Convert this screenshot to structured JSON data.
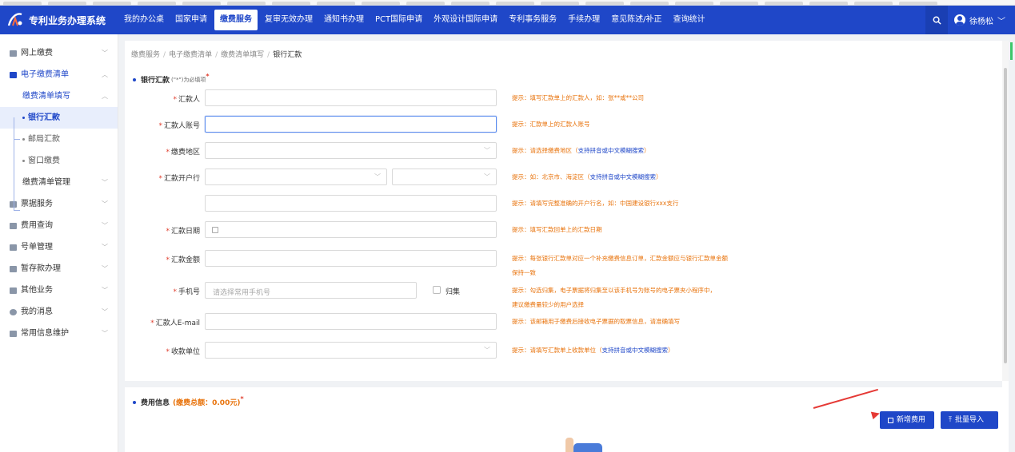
{
  "app": {
    "title": "专利业务办理系统"
  },
  "nav": {
    "items": [
      {
        "label": "我的办公桌"
      },
      {
        "label": "国家申请"
      },
      {
        "label": "缴费服务"
      },
      {
        "label": "复审无效办理"
      },
      {
        "label": "通知书办理"
      },
      {
        "label": "PCT国际申请"
      },
      {
        "label": "外观设计国际申请"
      },
      {
        "label": "专利事务服务"
      },
      {
        "label": "手续办理"
      },
      {
        "label": "意见陈述/补正"
      },
      {
        "label": "查询统计"
      }
    ],
    "active_index": 2,
    "user": "徐杨松"
  },
  "sidebar": {
    "items": [
      {
        "label": "网上缴费"
      },
      {
        "label": "电子缴费清单"
      },
      {
        "label": "缴费清单填写"
      },
      {
        "label": "银行汇款"
      },
      {
        "label": "邮局汇款"
      },
      {
        "label": "窗口缴费"
      },
      {
        "label": "缴费清单管理"
      },
      {
        "label": "票据服务"
      },
      {
        "label": "费用查询"
      },
      {
        "label": "号单管理"
      },
      {
        "label": "暂存款办理"
      },
      {
        "label": "其他业务"
      },
      {
        "label": "我的消息"
      },
      {
        "label": "常用信息维护"
      }
    ]
  },
  "breadcrumb": [
    "缴费服务",
    "电子缴费清单",
    "缴费清单填写",
    "银行汇款"
  ],
  "form": {
    "section_title": "银行汇款",
    "section_note": "(\"*\")为必填项",
    "fields": {
      "remitter": {
        "label": "汇款人",
        "hint": "提示：填写汇款单上的汇款人，如：张**或**公司"
      },
      "account": {
        "label": "汇款人账号",
        "hint": "提示：汇款单上的汇款人账号"
      },
      "region": {
        "label": "缴费地区",
        "hint": "提示：请选择缴费地区（",
        "hint_blue": "支持拼音或中文模糊搜索",
        "hint_end": "）"
      },
      "bank": {
        "label": "汇款开户行",
        "hint": "提示：如：北京市、海淀区（",
        "hint_blue": "支持拼音或中文模糊搜索",
        "hint_end": "）"
      },
      "bank_name": {
        "hint": "提示：请填写完整准确的开户行名，如：中国建设银行xxx支行"
      },
      "date": {
        "label": "汇款日期",
        "hint": "提示：填写汇款回单上的汇款日期"
      },
      "amount": {
        "label": "汇款金额",
        "hint": "提示：每张银行汇款单对应一个补充缴费信息订单，汇款金额应与银行汇款单金额",
        "hint2": "保持一致"
      },
      "phone": {
        "label": "手机号",
        "placeholder": "请选择常用手机号",
        "check_label": "归集",
        "hint": "提示：勾选归集，电子票据将归集至以该手机号为账号的电子票夹小程序中，",
        "hint2": "建议缴费量较少的用户选择"
      },
      "email": {
        "label": "汇款人E-mail",
        "hint": "提示：该邮箱用于缴费后接收电子票据的取票信息，请准确填写"
      },
      "payee": {
        "label": "收款单位",
        "hint": "提示：请填写汇款单上收款单位（",
        "hint_blue": "支持拼音或中文模糊搜索",
        "hint_end": "）"
      }
    }
  },
  "fee": {
    "title": "费用信息",
    "total": "(缴费总额：0.00元)",
    "add_button": "新增费用",
    "import_button": "批量导入"
  },
  "colors": {
    "primary": "#1f47c8",
    "hint": "#e8730c",
    "required": "#e03e2d",
    "annotation": "#e53935"
  }
}
